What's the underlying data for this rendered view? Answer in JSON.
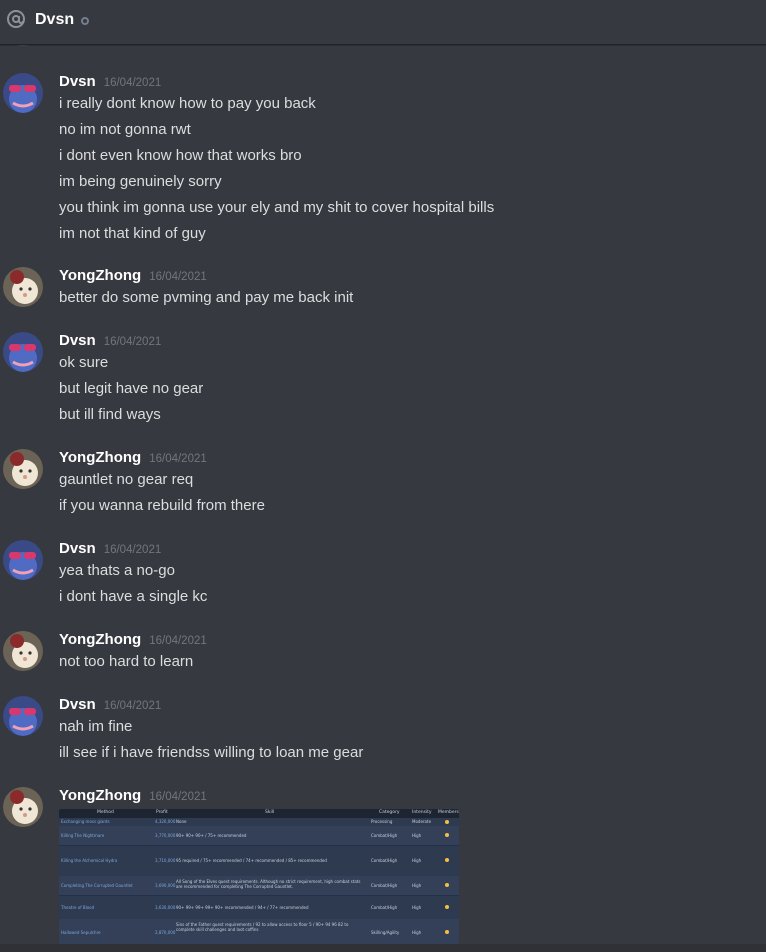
{
  "header": {
    "channel_name": "Dvsn",
    "icon": "at-icon",
    "status_icon": "offline-status-icon"
  },
  "colors": {
    "background": "#36393f",
    "username": "#ffffff",
    "timestamp": "#72767d",
    "text": "#dcddde"
  },
  "messages": [
    {
      "author": "Dvsn",
      "timestamp": "16/04/2021",
      "lines": [
        "i really dont know how to pay you back",
        "no im not gonna rwt",
        "i dont even know how that works bro",
        "im being genuinely sorry",
        "you think im gonna use your ely and my shit to cover hospital bills",
        "im not that kind of guy"
      ]
    },
    {
      "author": "YongZhong",
      "timestamp": "16/04/2021",
      "lines": [
        "better do some pvming and pay me back init"
      ]
    },
    {
      "author": "Dvsn",
      "timestamp": "16/04/2021",
      "lines": [
        "ok sure",
        "but legit have no gear",
        "but ill find ways"
      ]
    },
    {
      "author": "YongZhong",
      "timestamp": "16/04/2021",
      "lines": [
        "gauntlet no gear req",
        "if you wanna rebuild from there"
      ]
    },
    {
      "author": "Dvsn",
      "timestamp": "16/04/2021",
      "lines": [
        "yea thats a no-go",
        "i dont have a single kc"
      ]
    },
    {
      "author": "YongZhong",
      "timestamp": "16/04/2021",
      "lines": [
        "not too hard to learn"
      ]
    },
    {
      "author": "Dvsn",
      "timestamp": "16/04/2021",
      "lines": [
        "nah im fine",
        "ill see if i have friendss willing to loan me gear"
      ]
    },
    {
      "author": "YongZhong",
      "timestamp": "16/04/2021",
      "lines": []
    }
  ],
  "attachment": {
    "headers": [
      "Method",
      "Profit",
      "Skill",
      "Category",
      "Intensity",
      "Members"
    ],
    "rows": [
      {
        "method": "Exchanging moss giants",
        "profit": "4,320,000",
        "skill": "None",
        "category": "Processing",
        "intensity": "Moderate"
      },
      {
        "method": "Killing The Nightmare",
        "profit": "3,770,000",
        "skill": "90+ 90+ 90+ / 75+ recommended",
        "category": "Combat/High",
        "intensity": "High"
      },
      {
        "method": "Killing the Alchemical Hydra",
        "profit": "3,710,000",
        "skill": "95 required / 75+ recommended / 74+ recommended / 85+ recommended",
        "category": "Combat/High",
        "intensity": "High"
      },
      {
        "method": "Completing The Corrupted Gauntlet",
        "profit": "3,690,000",
        "skill": "All Song of the Elves quest requirements. Although no strict requirement, high combat stats are recommended for completing The Corrupted Gauntlet.",
        "category": "Combat/High",
        "intensity": "High"
      },
      {
        "method": "Theatre of Blood",
        "profit": "3,630,000",
        "skill": "90+ 99+ 99+ 99+ 90+ recommended / 94+ / 77+ recommended",
        "category": "Combat/High",
        "intensity": "High"
      },
      {
        "method": "Hallowed Sepulchre",
        "profit": "2,870,000",
        "skill": "Sins of the Father quest requirements / 92 to allow access to floor 5 / 90+ 94 96 82 to complete skill challenges and loot coffins",
        "category": "Skilling/Agility",
        "intensity": "High"
      }
    ]
  }
}
